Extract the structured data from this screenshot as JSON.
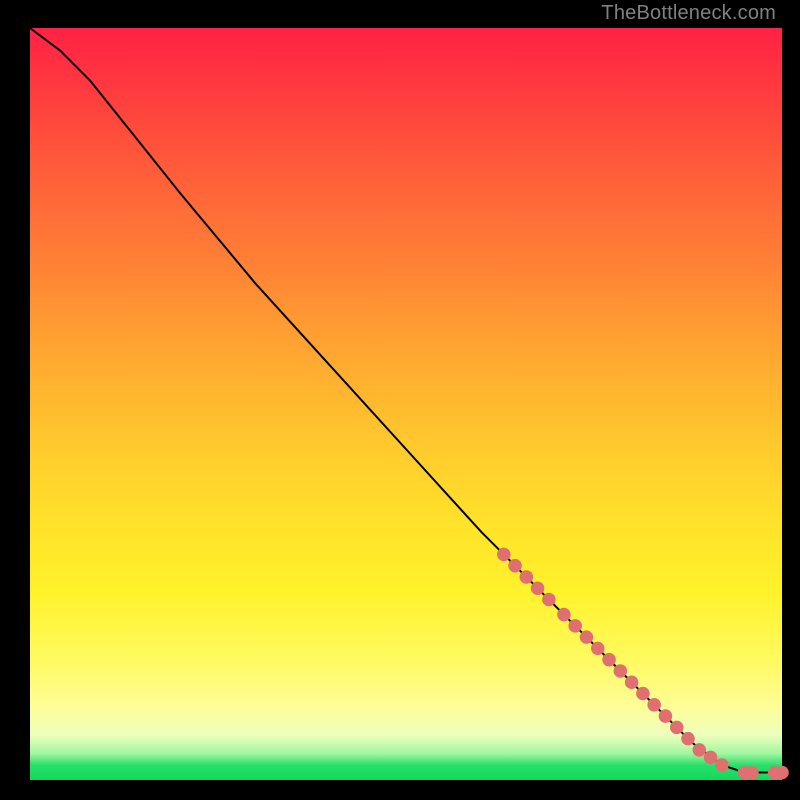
{
  "attribution": "TheBottleneck.com",
  "chart_data": {
    "type": "line",
    "title": "",
    "xlabel": "",
    "ylabel": "",
    "xlim": [
      0,
      100
    ],
    "ylim": [
      0,
      100
    ],
    "curve": {
      "x": [
        0,
        4,
        8,
        12,
        20,
        30,
        40,
        50,
        60,
        70,
        80,
        85,
        88,
        92,
        95,
        98,
        100
      ],
      "y": [
        100,
        97,
        93,
        88,
        78,
        66,
        55,
        44,
        33,
        23,
        13,
        8,
        5,
        2,
        1,
        1,
        1
      ]
    },
    "markers": [
      {
        "x": 63,
        "y": 30
      },
      {
        "x": 64.5,
        "y": 28.5
      },
      {
        "x": 66,
        "y": 27
      },
      {
        "x": 67.5,
        "y": 25.5
      },
      {
        "x": 69,
        "y": 24
      },
      {
        "x": 71,
        "y": 22
      },
      {
        "x": 72.5,
        "y": 20.5
      },
      {
        "x": 74,
        "y": 19
      },
      {
        "x": 75.5,
        "y": 17.5
      },
      {
        "x": 77,
        "y": 16
      },
      {
        "x": 78.5,
        "y": 14.5
      },
      {
        "x": 80,
        "y": 13
      },
      {
        "x": 81.5,
        "y": 11.5
      },
      {
        "x": 83,
        "y": 10
      },
      {
        "x": 84.5,
        "y": 8.5
      },
      {
        "x": 86,
        "y": 7
      },
      {
        "x": 87.5,
        "y": 5.5
      },
      {
        "x": 89,
        "y": 4
      },
      {
        "x": 90.5,
        "y": 3
      },
      {
        "x": 92,
        "y": 2
      },
      {
        "x": 95,
        "y": 1
      },
      {
        "x": 96,
        "y": 1
      },
      {
        "x": 99,
        "y": 1
      },
      {
        "x": 100,
        "y": 1
      }
    ],
    "colors": {
      "curve": "#000000",
      "marker": "#e07070",
      "gradient_top": "#ff2244",
      "gradient_mid": "#ffe22a",
      "gradient_bottom": "#10d959"
    }
  }
}
